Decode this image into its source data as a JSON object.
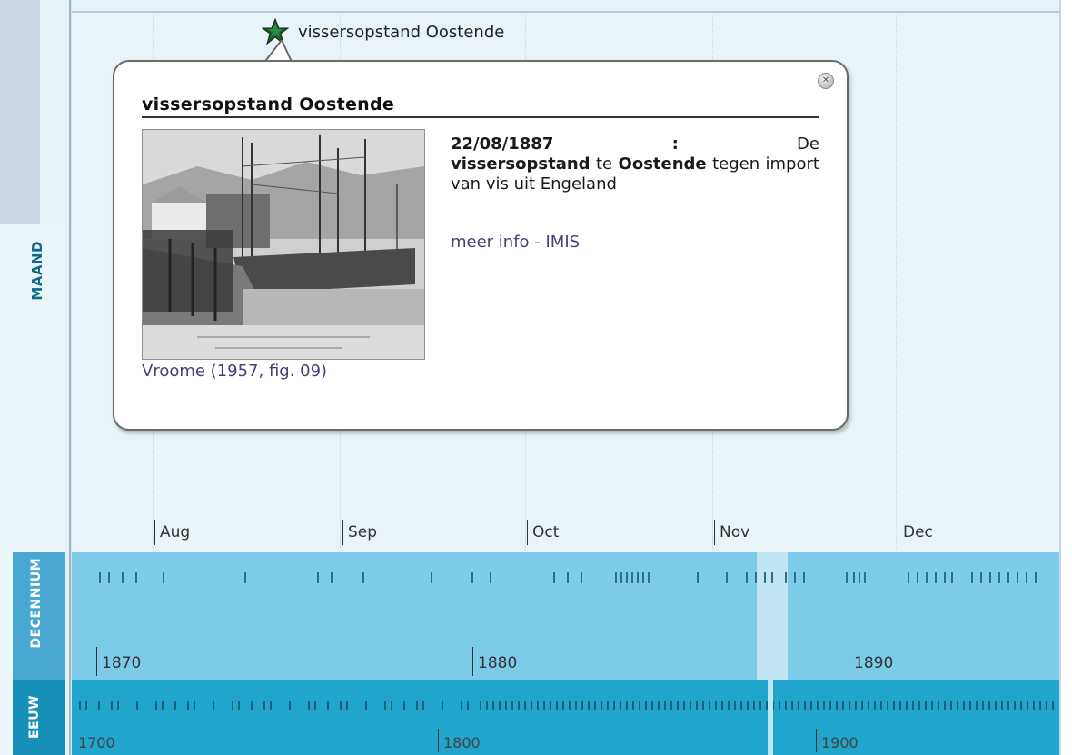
{
  "bands": {
    "maand_label": "MAAND",
    "decennium_label": "DECENNIUM",
    "eeuw_label": "EEUW"
  },
  "months": [
    "Aug",
    "Sep",
    "Oct",
    "Nov",
    "Dec"
  ],
  "decades": [
    "1870",
    "1880",
    "1890"
  ],
  "centuries": [
    "1700",
    "1800",
    "1900"
  ],
  "event": {
    "marker_label": "vissersopstand Oostende",
    "popup": {
      "title": "vissersopstand Oostende",
      "date": "22/08/1887",
      "separator": ":",
      "text_before": "De",
      "keyword1": "vissersopstand",
      "text_mid": "te",
      "keyword2": "Oostende",
      "text_after": "tegen import van vis uit Engeland",
      "more_info_link": "meer info - IMIS",
      "image_caption_link": "Vroome (1957, fig. 09)",
      "image_alt": "Oostende 1887. De vissersopstand",
      "close_icon": "close-icon"
    }
  },
  "colors": {
    "maand_bg": "#e9f4f9",
    "decennium_bg": "#7ccbe9",
    "eeuw_bg": "#20a5cd",
    "link": "#4a3c78",
    "accent_label": "#0e6a86"
  }
}
